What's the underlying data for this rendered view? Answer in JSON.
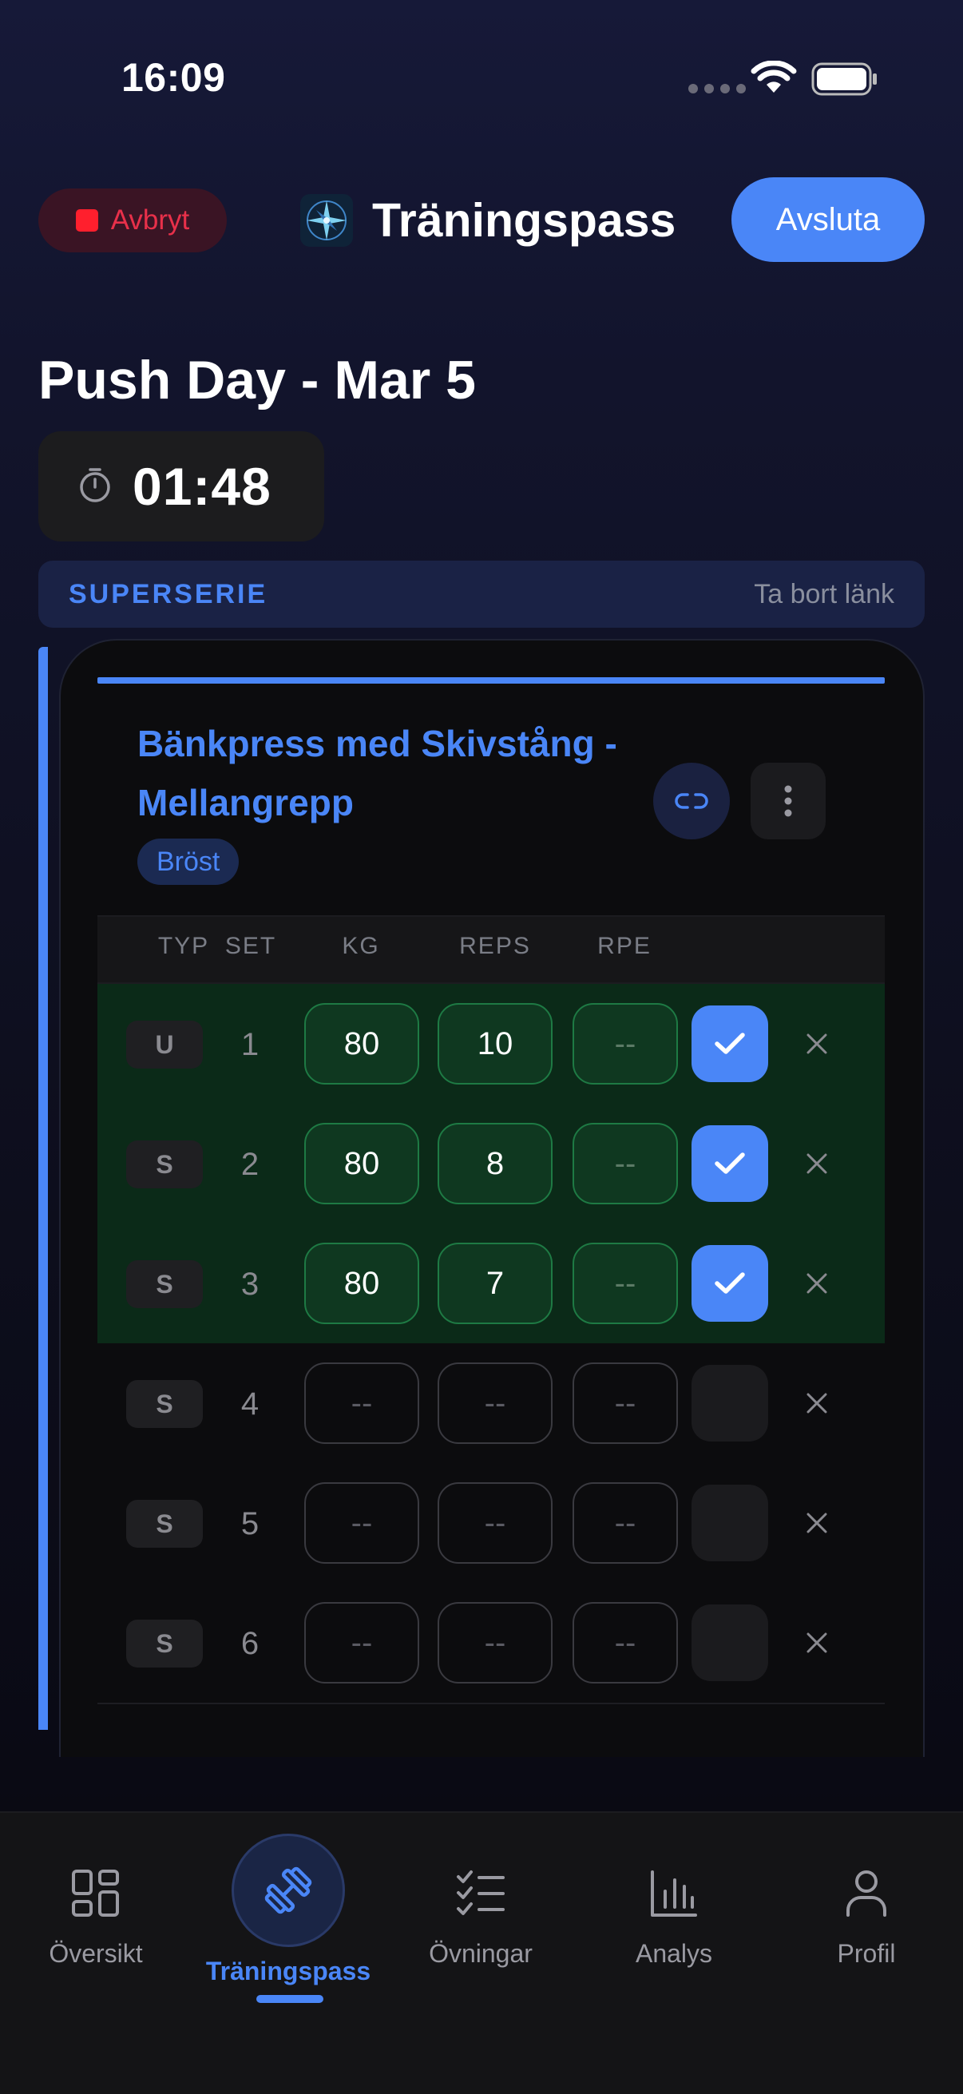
{
  "status_bar": {
    "time": "16:09"
  },
  "header": {
    "cancel_label": "Avbryt",
    "title": "Träningspass",
    "finish_label": "Avsluta"
  },
  "workout": {
    "title": "Push Day - Mar 5",
    "timer": "01:48"
  },
  "superset": {
    "label": "SUPERSERIE",
    "unlink_label": "Ta bort länk"
  },
  "exercise": {
    "name": "Bänkpress med Skivstång - Mellangrepp",
    "muscle_tag": "Bröst",
    "columns": [
      "TYP",
      "SET",
      "KG",
      "REPS",
      "RPE"
    ],
    "sets": [
      {
        "type": "U",
        "set": "1",
        "kg": "80",
        "reps": "10",
        "rpe": "--",
        "completed": true
      },
      {
        "type": "S",
        "set": "2",
        "kg": "80",
        "reps": "8",
        "rpe": "--",
        "completed": true
      },
      {
        "type": "S",
        "set": "3",
        "kg": "80",
        "reps": "7",
        "rpe": "--",
        "completed": true
      },
      {
        "type": "S",
        "set": "4",
        "kg": "--",
        "reps": "--",
        "rpe": "--",
        "completed": false
      },
      {
        "type": "S",
        "set": "5",
        "kg": "--",
        "reps": "--",
        "rpe": "--",
        "completed": false
      },
      {
        "type": "S",
        "set": "6",
        "kg": "--",
        "reps": "--",
        "rpe": "--",
        "completed": false
      }
    ]
  },
  "nav": {
    "items": [
      {
        "label": "Översikt",
        "icon": "grid-icon"
      },
      {
        "label": "Träningspass",
        "icon": "dumbbell-icon",
        "active": true
      },
      {
        "label": "Övningar",
        "icon": "checklist-icon"
      },
      {
        "label": "Analys",
        "icon": "bar-chart-icon"
      },
      {
        "label": "Profil",
        "icon": "person-icon"
      }
    ]
  },
  "colors": {
    "accent": "#4a86f7",
    "cancel": "#e8304a",
    "completed_row": "#0b2a18",
    "completed_border": "#1e7a44"
  }
}
